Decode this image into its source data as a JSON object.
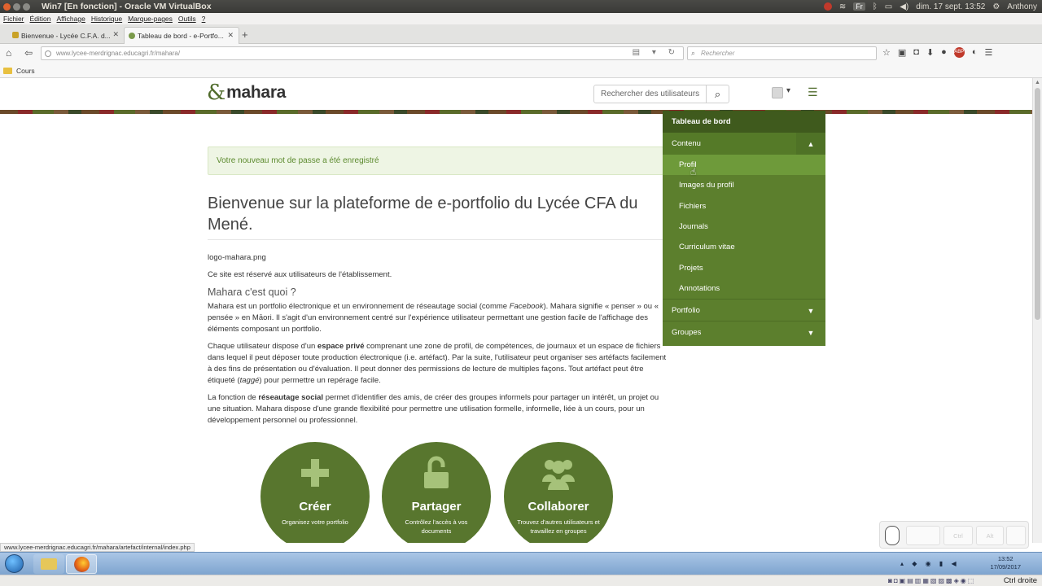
{
  "window": {
    "title": "Win7 [En fonction] - Oracle VM VirtualBox",
    "clock": "dim. 17 sept. 13:52",
    "user": "Anthony",
    "keyboard_layout": "Fr"
  },
  "menubar": [
    "Fichier",
    "Édition",
    "Affichage",
    "Historique",
    "Marque-pages",
    "Outils",
    "?"
  ],
  "tabs": [
    {
      "label": "Bienvenue - Lycée C.F.A. d..."
    },
    {
      "label": "Tableau de bord - e-Portfo..."
    }
  ],
  "navbar": {
    "url": "www.lycee-merdrignac.educagri.fr/mahara/",
    "search_placeholder": "Rechercher"
  },
  "bookmarks": [
    "Cours"
  ],
  "site": {
    "logo_text": "mahara",
    "user_search_placeholder": "Rechercher des utilisateurs",
    "alert": "Votre nouveau mot de passe a été enregistré",
    "heading": "Bienvenue sur la plateforme de e-portfolio du Lycée CFA du Mené.",
    "image_alt": "logo-mahara.png",
    "reserved": "Ce site est réservé aux utilisateurs de l'établissement.",
    "subheading": "Mahara c'est quoi ?",
    "p1": {
      "a": "Mahara est  un portfolio électronique et un environnement de réseautage social (comme ",
      "b": "Facebook",
      "c": "). Mahara signifie « penser » ou « pensée » en Māori. Il s'agit d'un environnement centré sur l'expérience utilisateur permettant une gestion facile de l'affichage des éléments composant un portfolio."
    },
    "p2": {
      "a": "Chaque utilisateur dispose d'un ",
      "b": "espace privé",
      "c": " comprenant une zone de profil, de compétences, de journaux et un espace de fichiers dans lequel il peut déposer toute production électronique (i.e. artéfact). Par la suite, l'utilisateur peut organiser ses artéfacts facilement à des fins de présentation ou d'évaluation. Il peut donner des permissions de lecture de multiples façons. Tout artéfact peut être étiqueté (",
      "d": "taggé",
      "e": ") pour permettre un repérage facile."
    },
    "p3": {
      "a": "La fonction de ",
      "b": "réseautage social",
      "c": " permet d'identifier des amis, de créer des groupes informels pour partager un intérêt, un projet ou une situation. Mahara dispose d'une grande flexibilité pour permettre une utilisation formelle, informelle, liée à un cours, pour un développement personnel ou professionnel."
    },
    "features": [
      {
        "title": "Créer",
        "subtitle": "Organisez votre portfolio",
        "icon": "plus-icon"
      },
      {
        "title": "Partager",
        "subtitle": "Contrôlez l'accès à vos documents",
        "icon": "unlock-icon"
      },
      {
        "title": "Collaborer",
        "subtitle": "Trouvez d'autres utilisateurs et travaillez en groupes",
        "icon": "users-icon"
      }
    ]
  },
  "menu": {
    "dashboard": "Tableau de bord",
    "content": "Contenu",
    "content_items": [
      "Profil",
      "Images du profil",
      "Fichiers",
      "Journals",
      "Curriculum vitae",
      "Projets",
      "Annotations"
    ],
    "portfolio": "Portfolio",
    "groups": "Groupes"
  },
  "status_url": "www.lycee-merdrignac.educagri.fr/mahara/artefact/internal/index.php",
  "osk": {
    "keys": [
      "Ctrl",
      "Alt"
    ]
  },
  "taskbar": {
    "time": "13:52",
    "date": "17/09/2017"
  },
  "vbox": {
    "host_key": "Ctrl droite"
  },
  "colors": {
    "mahara_green": "#58762e",
    "menu_dark": "#3f5a1d",
    "alert_text": "#5c8a2e"
  }
}
